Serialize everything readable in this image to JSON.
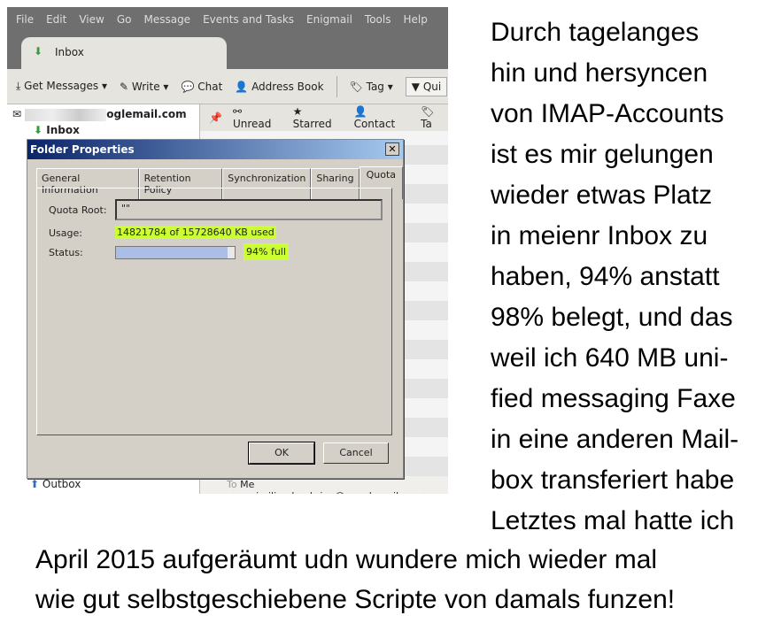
{
  "menu": [
    "File",
    "Edit",
    "View",
    "Go",
    "Message",
    "Events and Tasks",
    "Enigmail",
    "Tools",
    "Help"
  ],
  "tab": {
    "label": "Inbox"
  },
  "toolbar": {
    "get_messages": "Get Messages",
    "write": "Write",
    "chat": "Chat",
    "address_book": "Address Book",
    "tag": "Tag",
    "quick": "Qui"
  },
  "folders": {
    "account": "oglemail.com",
    "inbox": "Inbox",
    "outbox": "Outbox"
  },
  "filters": [
    "Unread",
    "Starred",
    "Contact",
    "Ta"
  ],
  "to_line": {
    "label": "To",
    "value": "Me <maximilian.baehring@googlemail.com>"
  },
  "dialog": {
    "title": "Folder Properties",
    "tabs": [
      "General Information",
      "Retention Policy",
      "Synchronization",
      "Sharing",
      "Quota"
    ],
    "active_tab": "Quota",
    "quota_root_label": "Quota Root:",
    "quota_root_value": "\"\"",
    "usage_label": "Usage:",
    "usage_value": "14821784 of 15728640 KB used",
    "status_label": "Status:",
    "status_percent": 94,
    "status_text": "94% full",
    "ok": "OK",
    "cancel": "Cancel"
  },
  "highlight_color": "#ccff33",
  "note_right": [
    "Durch tagelanges",
    "hin und hersyncen",
    "von IMAP-Accounts",
    "ist es mir gelungen",
    "wieder etwas Platz",
    "in meienr Inbox zu",
    "haben, 94% anstatt",
    "98% belegt, und das",
    "weil ich 640 MB uni-",
    "fied messaging Faxe",
    "in eine anderen Mail-",
    "box transferiert habe",
    " Letztes mal hatte ich"
  ],
  "note_bottom": [
    "April 2015 aufgeräumt udn wundere mich wieder mal",
    "wie gut selbstgeschiebene Scripte von damals funzen!"
  ]
}
